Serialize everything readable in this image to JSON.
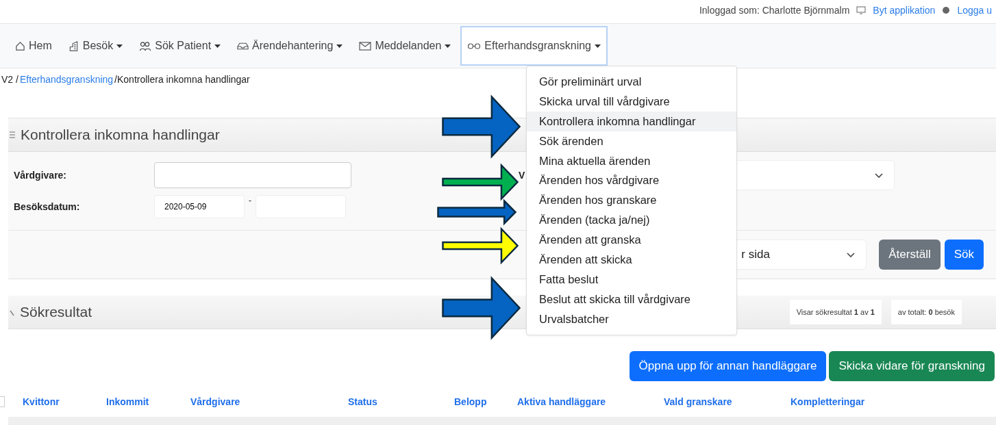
{
  "top_bar": {
    "user": "Inloggad som: Charlotte Björnmalm",
    "switch_app": "Byt applikation",
    "logout": "Logga u"
  },
  "nav": [
    {
      "label": "Hem",
      "dropdown": false,
      "selected": false
    },
    {
      "label": "Besök",
      "dropdown": true,
      "selected": false
    },
    {
      "label": "Sök Patient",
      "dropdown": true,
      "selected": false
    },
    {
      "label": "Ärendehantering",
      "dropdown": true,
      "selected": false
    },
    {
      "label": "Meddelanden",
      "dropdown": true,
      "selected": false
    },
    {
      "label": "Efterhandsgranskning",
      "dropdown": true,
      "selected": true
    }
  ],
  "breadcrumb": [
    {
      "label": "V2 /",
      "link": false
    },
    {
      "label": "Efterhandsgranskning",
      "link": true
    },
    {
      "label": "/Kontrollera inkomna handlingar",
      "link": false
    }
  ],
  "search_panel": {
    "title": "Kontrollera inkomna handlingar",
    "fields": [
      {
        "label": "Vårdgivare:"
      },
      {
        "label": "Besöksdatum:",
        "from": "2020-05-09",
        "separator": "-"
      }
    ],
    "hidden_label": "V",
    "per_page": "r sida",
    "reset": "Återställ",
    "search": "Sök"
  },
  "results": {
    "title": "Sökresultat",
    "showing": "Visar sökresultat **1** av **1**",
    "total": "av totalt: **0** besök"
  },
  "actions": [
    {
      "label": "Öppna upp för annan handläggare",
      "kind": "primary"
    },
    {
      "label": "Skicka vidare för granskning",
      "kind": "success"
    }
  ],
  "header_checkbox": {
    "checked": false
  },
  "columns": [
    "Kvittonr",
    "Inkommit",
    "Vårdgivare",
    "Status",
    "Belopp",
    "Aktiva handläggare",
    "Vald granskare",
    "Kompletteringar"
  ],
  "menu": [
    {
      "label": "Gör preliminärt urval",
      "selected": false
    },
    {
      "label": "Skicka urval till vårdgivare",
      "selected": false
    },
    {
      "label": "Kontrollera inkomna handlingar",
      "selected": true
    },
    {
      "label": "Sök ärenden",
      "selected": false
    },
    {
      "label": "Mina aktuella ärenden",
      "selected": false
    },
    {
      "label": "Ärenden hos vårdgivare",
      "selected": false
    },
    {
      "label": "Ärenden hos granskare",
      "selected": false
    },
    {
      "label": "Ärenden (tacka ja/nej)",
      "selected": false
    },
    {
      "label": "Ärenden att granska",
      "selected": false
    },
    {
      "label": "Ärenden att skicka",
      "selected": false
    },
    {
      "label": "Fatta beslut",
      "selected": false
    },
    {
      "label": "Beslut att skicka till vårdgivare",
      "selected": false
    },
    {
      "label": "Urvalsbatcher",
      "selected": false
    }
  ],
  "annotations": [
    {
      "kind": "large",
      "color": "#0563c1"
    },
    {
      "kind": "medium",
      "color": "#00b050"
    },
    {
      "kind": "thin",
      "color": "#0563c1"
    },
    {
      "kind": "medium",
      "color": "#ffff00"
    },
    {
      "kind": "large",
      "color": "#0563c1"
    }
  ]
}
